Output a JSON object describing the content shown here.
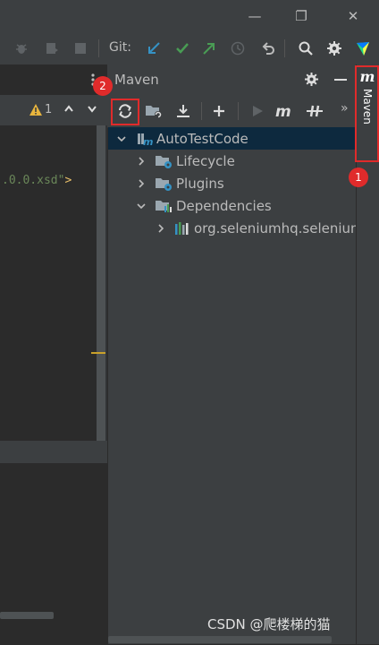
{
  "window": {
    "minimize": "—",
    "restore": "❐",
    "close": "✕"
  },
  "toolbar": {
    "git_label": "Git:"
  },
  "editor": {
    "warnings": "1",
    "code_fragment": ".0.0.xsd\"",
    "code_close": ">"
  },
  "maven": {
    "title": "Maven",
    "tree": [
      {
        "label": "AutoTestCode"
      },
      {
        "label": "Lifecycle"
      },
      {
        "label": "Plugins"
      },
      {
        "label": "Dependencies"
      },
      {
        "label": "org.seleniumhq.selenium"
      }
    ],
    "more": "»"
  },
  "sidebar": {
    "maven_tab_icon": "m",
    "maven_tab_label": "Maven"
  },
  "annotations": {
    "badge1": "1",
    "badge2": "2"
  },
  "watermark": "CSDN @爬楼梯的猫",
  "colors": {
    "accent_red": "#e02b2b",
    "selection_bg": "#0d293e",
    "panel_bg": "#3c3f41",
    "editor_bg": "#2b2b2b"
  }
}
